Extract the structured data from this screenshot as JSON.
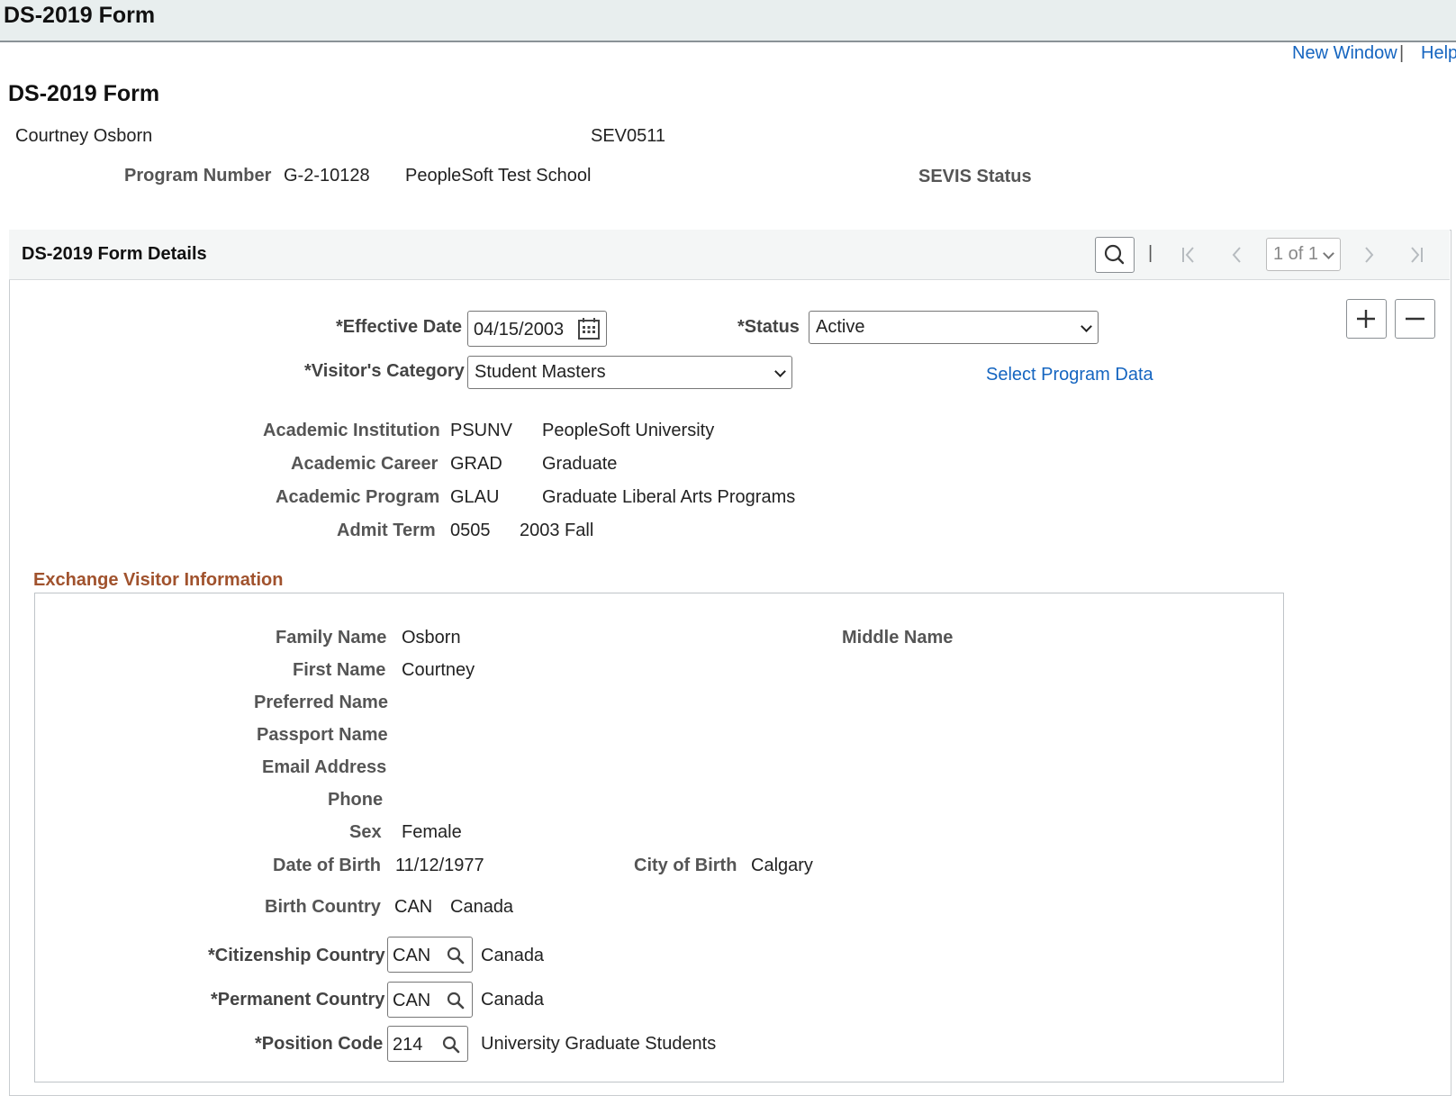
{
  "window": {
    "title": "DS-2019 Form"
  },
  "top_links": {
    "new_window": "New Window",
    "separator": "|",
    "help": "Help"
  },
  "page": {
    "title": "DS-2019 Form",
    "student_name": "Courtney Osborn",
    "sevis_id": "SEV0511",
    "program_number_label": "Program Number",
    "program_number": "G-2-10128",
    "school_name": "PeopleSoft Test School",
    "sevis_status_label": "SEVIS Status"
  },
  "details": {
    "header": "DS-2019 Form Details",
    "nav": {
      "separator": "|",
      "page_indicator": "1 of 1"
    },
    "effective_date_label": "*Effective Date",
    "effective_date": "04/15/2003",
    "status_label": "*Status",
    "status": "Active",
    "visitor_category_label": "*Visitor's Category",
    "visitor_category": "Student Masters",
    "select_program_link": "Select Program Data",
    "academic": {
      "institution_label": "Academic Institution",
      "institution_code": "PSUNV",
      "institution_name": "PeopleSoft University",
      "career_label": "Academic Career",
      "career_code": "GRAD",
      "career_name": "Graduate",
      "program_label": "Academic Program",
      "program_code": "GLAU",
      "program_name": "Graduate Liberal Arts Programs",
      "admit_term_label": "Admit Term",
      "admit_term_code": "0505",
      "admit_term_name": "2003 Fall"
    }
  },
  "exchange": {
    "section_title": "Exchange Visitor Information",
    "family_name_label": "Family Name",
    "family_name": "Osborn",
    "middle_name_label": "Middle Name",
    "first_name_label": "First Name",
    "first_name": "Courtney",
    "preferred_name_label": "Preferred Name",
    "passport_name_label": "Passport Name",
    "email_label": "Email Address",
    "phone_label": "Phone",
    "sex_label": "Sex",
    "sex": "Female",
    "dob_label": "Date of Birth",
    "dob": "11/12/1977",
    "city_of_birth_label": "City of Birth",
    "city_of_birth": "Calgary",
    "birth_country_label": "Birth Country",
    "birth_country_code": "CAN",
    "birth_country_name": "Canada",
    "citizenship_label": "*Citizenship Country",
    "citizenship_code": "CAN",
    "citizenship_name": "Canada",
    "permanent_label": "*Permanent Country",
    "permanent_code": "CAN",
    "permanent_name": "Canada",
    "position_label": "*Position Code",
    "position_code": "214",
    "position_name": "University Graduate Students"
  },
  "icons": {
    "search": "search-icon",
    "calendar": "calendar-icon",
    "first": "first-page-icon",
    "previous": "previous-icon",
    "next": "next-icon",
    "last": "last-page-icon",
    "add": "plus-icon",
    "delete": "minus-icon",
    "dropdown": "chevron-down-icon"
  },
  "colors": {
    "link": "#1565c0",
    "section_title": "#a0522d",
    "title_bar_bg": "#e8eeee",
    "label": "#555555"
  }
}
